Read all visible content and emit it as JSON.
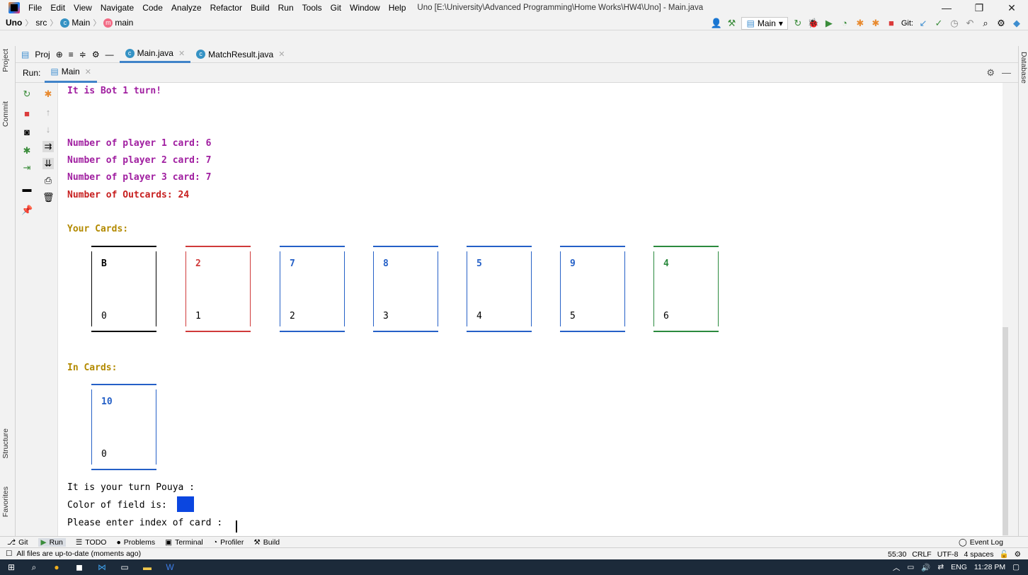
{
  "titlebar": {
    "menu": [
      "File",
      "Edit",
      "View",
      "Navigate",
      "Code",
      "Analyze",
      "Refactor",
      "Build",
      "Run",
      "Tools",
      "Git",
      "Window",
      "Help"
    ],
    "window_title": "Uno [E:\\University\\Advanced Programming\\Home Works\\HW4\\Uno] - Main.java",
    "minimize": "—",
    "restore": "❐",
    "close": "✕"
  },
  "navbar": {
    "crumbs": [
      "Uno",
      "src",
      "Main",
      "main"
    ],
    "run_config": "Main",
    "git_label": "Git:"
  },
  "left_tabs": {
    "project": "Project",
    "commit": "Commit",
    "structure": "Structure",
    "favorites": "Favorites"
  },
  "right_tabs": {
    "database": "Database"
  },
  "editor_tabs": {
    "project_tool": "Proj",
    "tabs": [
      "Main.java",
      "MatchResult.java"
    ]
  },
  "run_panel": {
    "label": "Run:",
    "tab": "Main"
  },
  "console": {
    "bot_turn": "It is Bot 1 turn!",
    "counts": [
      "Number of player 1 card: 6",
      "Number of player 2 card: 7",
      "Number of player 3 card: 7"
    ],
    "outcards": "Number of Outcards: 24",
    "your_cards_heading": "Your Cards:",
    "your_cards": [
      {
        "value": "B",
        "index": "0",
        "color": "black"
      },
      {
        "value": "2",
        "index": "1",
        "color": "red"
      },
      {
        "value": "7",
        "index": "2",
        "color": "blue"
      },
      {
        "value": "8",
        "index": "3",
        "color": "blue"
      },
      {
        "value": "5",
        "index": "4",
        "color": "blue"
      },
      {
        "value": "9",
        "index": "5",
        "color": "blue"
      },
      {
        "value": "4",
        "index": "6",
        "color": "green"
      }
    ],
    "in_cards_heading": "In Cards:",
    "in_card": {
      "value": "10",
      "index": "0",
      "color": "blue"
    },
    "your_turn": "It is your turn Pouya :",
    "field_color_label": "Color of field is:",
    "field_color": "#0b46e0",
    "prompt": "Please enter index of card :"
  },
  "bottom_tools": {
    "items": [
      "Git",
      "Run",
      "TODO",
      "Problems",
      "Terminal",
      "Profiler",
      "Build"
    ],
    "event_log": "Event Log"
  },
  "statusbar": {
    "message": "All files are up-to-date (moments ago)",
    "position": "55:30",
    "line_sep": "CRLF",
    "encoding": "UTF-8",
    "indent": "4 spaces"
  },
  "taskbar": {
    "lang": "ENG",
    "time": "11:28 PM"
  },
  "colors": {
    "purple": "#a01ea0",
    "red": "#c71f1f",
    "gold": "#b38a00",
    "card_blue": "#2560c7",
    "card_red": "#d03a3a",
    "card_green": "#2b8a3e",
    "accent": "#4083c9"
  }
}
